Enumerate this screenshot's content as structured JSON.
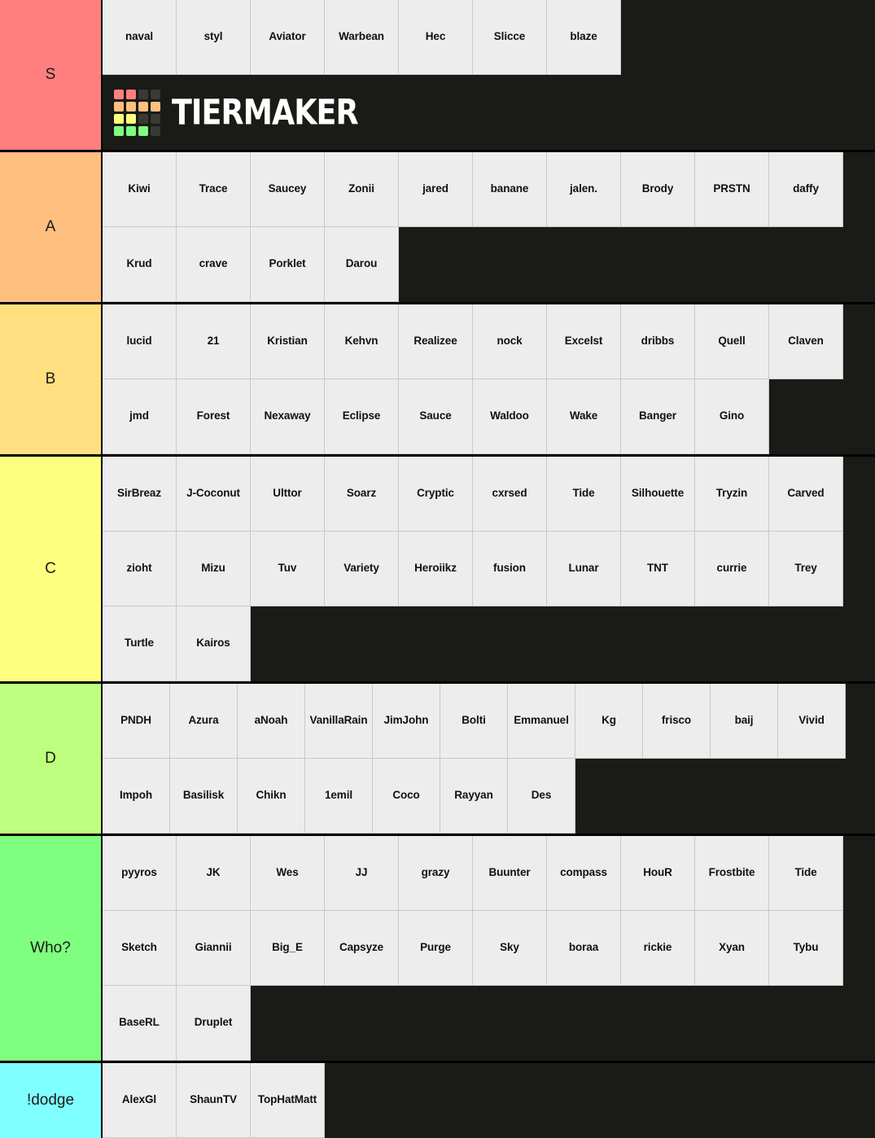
{
  "brand": {
    "name": "TIERMAKER",
    "logo_grid_colors": [
      "#ff7f7f",
      "#ff7f7f",
      "#3a3a34",
      "#3a3a34",
      "#ffbf7f",
      "#ffbf7f",
      "#ffbf7f",
      "#ffbf7f",
      "#ffff7f",
      "#ffff7f",
      "#3a3a34",
      "#3a3a34",
      "#7fff7f",
      "#7fff7f",
      "#7fff7f",
      "#3a3a34"
    ]
  },
  "colors": {
    "tier_s": "#ff7f7f",
    "tier_a": "#ffbf7f",
    "tier_b": "#ffdf7f",
    "tier_c": "#ffff7f",
    "tier_d": "#bfff7f",
    "tier_who": "#7fff7f",
    "tier_dodge": "#7fffff",
    "cell_bg": "#ededed",
    "background": "#1a1a16",
    "cell_text": "#111111"
  },
  "tiers": [
    {
      "label": "S",
      "color": "#ff7f7f",
      "has_logo": true,
      "items": [
        "naval",
        "styl",
        "Aviator",
        "Warbean",
        "Hec",
        "Slicce",
        "blaze"
      ]
    },
    {
      "label": "A",
      "color": "#ffbf7f",
      "has_logo": false,
      "items": [
        "Kiwi",
        "Trace",
        "Saucey",
        "Zonii",
        "jared",
        "banane",
        "jalen.",
        "Brody",
        "PRSTN",
        "daffy",
        "Krud",
        "crave",
        "Porklet",
        "Darou"
      ]
    },
    {
      "label": "B",
      "color": "#ffdf7f",
      "has_logo": false,
      "items": [
        "lucid",
        "21",
        "Kristian",
        "Kehvn",
        "Realizee",
        "nock",
        "Excelst",
        "dribbs",
        "Quell",
        "Claven",
        "jmd",
        "Forest",
        "Nexaway",
        "Eclipse",
        "Sauce",
        "Waldoo",
        "Wake",
        "Banger",
        "Gino"
      ]
    },
    {
      "label": "C",
      "color": "#ffff7f",
      "has_logo": false,
      "items": [
        "SirBreaz",
        "J-Coconut",
        "Ulttor",
        "Soarz",
        "Cryptic",
        "cxrsed",
        "Tide",
        "Silhouette",
        "Tryzin",
        "Carved",
        "zioht",
        "Mizu",
        "Tuv",
        "Variety",
        "Heroiikz",
        "fusion",
        "Lunar",
        "TNT",
        "currie",
        "Trey",
        "Turtle",
        "Kairos"
      ]
    },
    {
      "label": "D",
      "color": "#bfff7f",
      "has_logo": false,
      "items": [
        "PNDH",
        "Azura",
        "aNoah",
        "VanillaRain",
        "JimJohn",
        "Bolti",
        "Emmanuel",
        "Kg",
        "frisco",
        "baij",
        "Vivid",
        "Impoh",
        "Basilisk",
        "Chikn",
        "1emil",
        "Coco",
        "Rayyan",
        "Des"
      ]
    },
    {
      "label": "Who?",
      "color": "#7fff7f",
      "has_logo": false,
      "items": [
        "pyyros",
        "JK",
        "Wes",
        "JJ",
        "grazy",
        "Buunter",
        "compass",
        "HouR",
        "Frostbite",
        "Tide",
        "Sketch",
        "Giannii",
        "Big_E",
        "Capsyze",
        "Purge",
        "Sky",
        "boraa",
        "rickie",
        "Xyan",
        "Tybu",
        "BaseRL",
        "Druplet"
      ]
    },
    {
      "label": "!dodge",
      "color": "#7fffff",
      "has_logo": false,
      "items": [
        "AlexGl",
        "ShaunTV",
        "TopHatMatt"
      ]
    }
  ]
}
